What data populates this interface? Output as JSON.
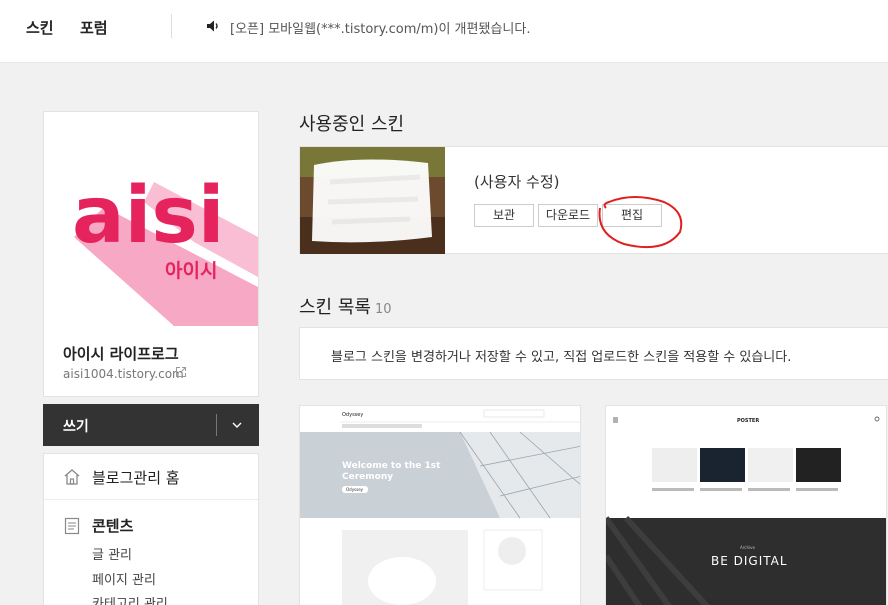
{
  "nav": {
    "skin": "스킨",
    "forum": "포럼"
  },
  "notice": {
    "text": "[오픈] 모바일웹(***.tistory.com/m)이 개편됐습니다."
  },
  "profile": {
    "logo_text": "aisi",
    "logo_subtext": "아이시",
    "blog_name": "아이시 라이프로그",
    "blog_url": "aisi1004.tistory.com"
  },
  "write": {
    "label": "쓰기"
  },
  "menu": {
    "home": "블로그관리 홈",
    "contents": "콘텐츠",
    "items": [
      "글 관리",
      "페이지 관리",
      "카테고리 관리"
    ]
  },
  "current": {
    "title": "사용중인 스킨",
    "name": "(사용자 수정)",
    "buttons": {
      "archive": "보관",
      "download": "다운로드",
      "edit": "편집"
    }
  },
  "list": {
    "title": "스킨 목록",
    "count": "10",
    "info": "블로그 스킨을 변경하거나 저장할 수 있고, 직접 업로드한 스킨을 적용할 수 있습니다."
  },
  "skins": [
    {
      "name": "Odyssey",
      "hero_title": "Welcome to the 1st\nCeremony",
      "hero_btn": "Odyssey"
    },
    {
      "name": "POSTER",
      "hero_small": "Archive",
      "hero_title": "BE DIGITAL"
    }
  ],
  "colors": {
    "brand_pink": "#e5245e",
    "pink_light": "#f7a8c5",
    "dark_bar": "#333333",
    "annotation_red": "#e02020"
  }
}
